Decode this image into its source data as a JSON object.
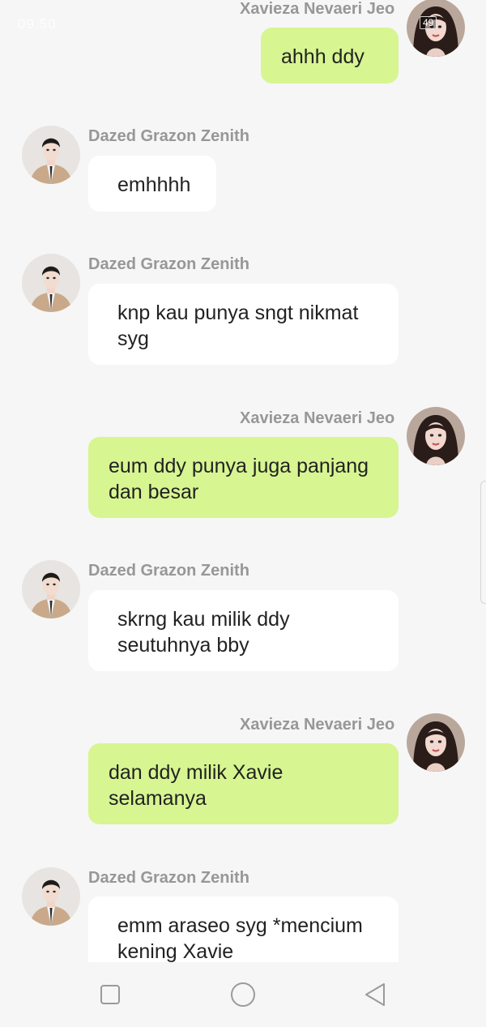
{
  "status_bar": {
    "time": "09.50",
    "battery": "49"
  },
  "colors": {
    "background": "#f6f6f6",
    "incoming_bubble": "#ffffff",
    "outgoing_bubble": "#d7f591",
    "sender_name": "#979797"
  },
  "chat": {
    "messages": [
      {
        "sender": "Xavieza Nevaeri Jeo",
        "side": "right",
        "text": "ahhh ddy"
      },
      {
        "sender": "Dazed Grazon Zenith",
        "side": "left",
        "text": "emhhhh"
      },
      {
        "sender": "Dazed Grazon Zenith",
        "side": "left",
        "text": "knp kau punya sngt nikmat syg"
      },
      {
        "sender": "Xavieza Nevaeri Jeo",
        "side": "right",
        "text": "eum ddy punya juga panjang dan besar"
      },
      {
        "sender": "Dazed Grazon Zenith",
        "side": "left",
        "text": "skrng kau milik ddy seutuhnya bby"
      },
      {
        "sender": "Xavieza Nevaeri Jeo",
        "side": "right",
        "text": "dan ddy milik Xavie selamanya"
      },
      {
        "sender": "Dazed Grazon Zenith",
        "side": "left",
        "text": "emm araseo syg *mencium kening Xavie"
      }
    ]
  },
  "navbar": {
    "icons": [
      "recent-apps-icon",
      "home-icon",
      "back-icon"
    ]
  }
}
